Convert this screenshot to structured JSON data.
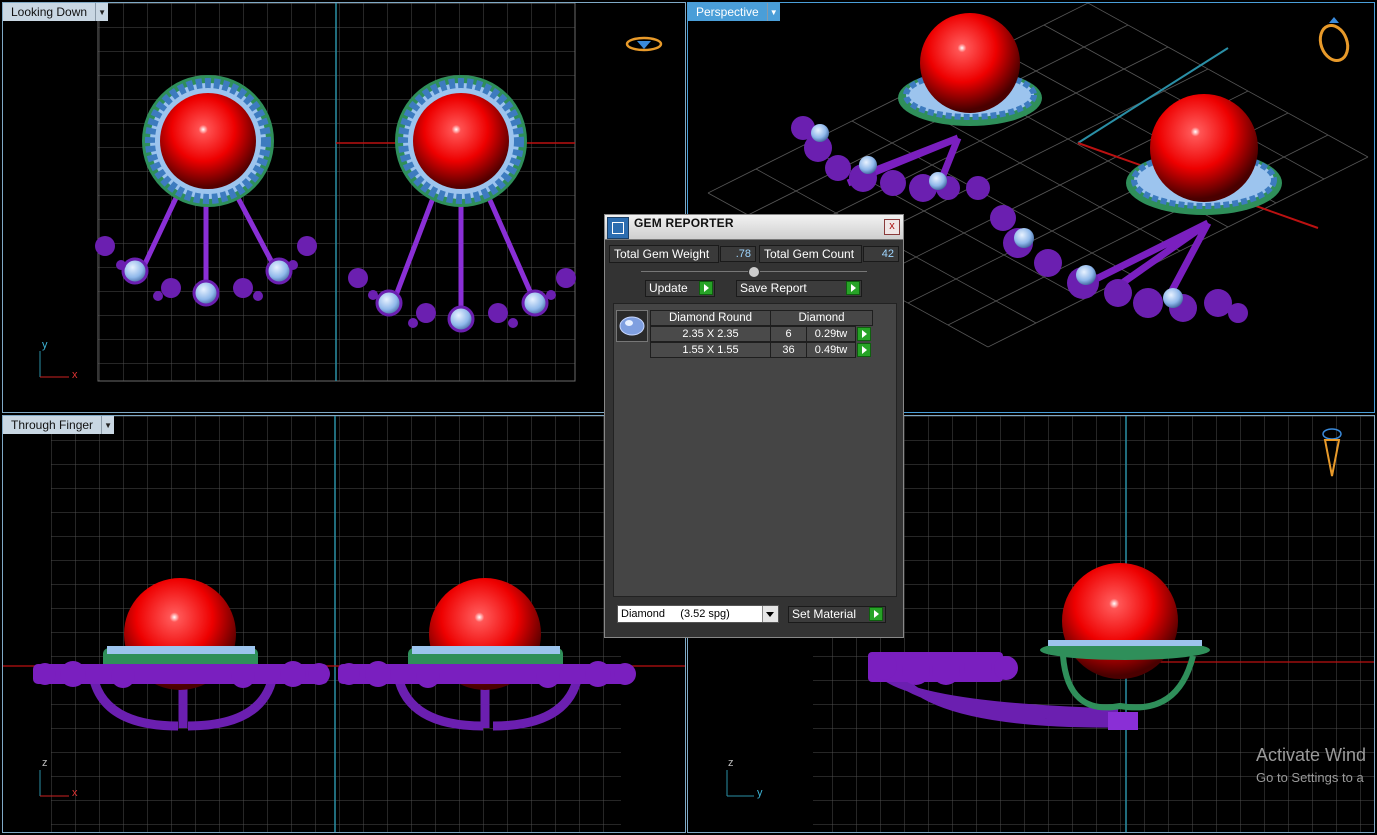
{
  "viewports": {
    "top_left": {
      "label": "Looking Down",
      "axis_v": "y",
      "axis_h": "x"
    },
    "top_right": {
      "label": "Perspective"
    },
    "bottom_left": {
      "label": "Through Finger",
      "axis_v": "z",
      "axis_h": "x"
    },
    "bottom_right": {
      "axis_v": "z",
      "axis_h": "y"
    }
  },
  "gem_reporter": {
    "title": "GEM REPORTER",
    "close_label": "x",
    "total_weight_label": "Total Gem Weight",
    "total_weight_value": ".78",
    "total_count_label": "Total Gem Count",
    "total_count_value": "42",
    "update_label": "Update",
    "save_label": "Save Report",
    "table_headers": [
      "Diamond Round",
      "Diamond"
    ],
    "rows": [
      {
        "size": "2.35 X 2.35",
        "count": "6",
        "weight": "0.29tw"
      },
      {
        "size": "1.55 X 1.55",
        "count": "36",
        "weight": "0.49tw"
      }
    ],
    "material_value": "Diamond     (3.52 spg)",
    "set_material_label": "Set Material"
  },
  "watermark": {
    "line1": "Activate Wind",
    "line2": "Go to Settings to a"
  },
  "colors": {
    "accent": "#4a9ed8",
    "grid": "#5a5a5a",
    "ruby": "#e01010",
    "metal_purple": "#7a1fbf",
    "gem_blue": "#8fb8ea"
  }
}
